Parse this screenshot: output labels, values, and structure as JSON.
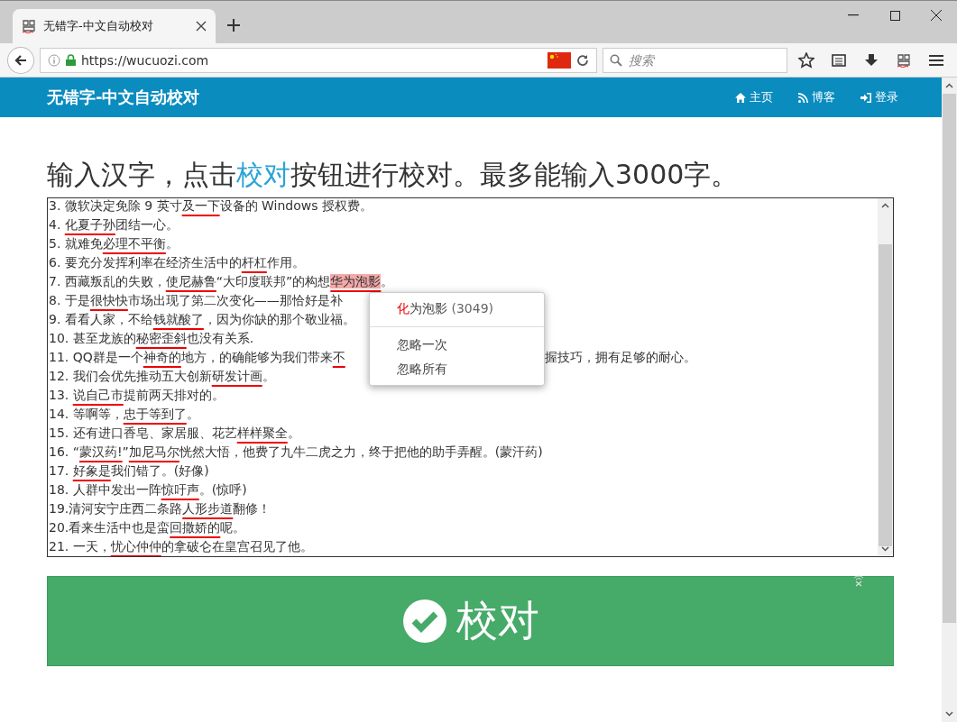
{
  "browser": {
    "tab_title": "无错字-中文自动校对",
    "url": "https://wucuozi.com",
    "search": {
      "placeholder": "搜索"
    }
  },
  "nav": {
    "brand": "无错字-中文自动校对",
    "links": [
      {
        "kind": "home",
        "label": "主页"
      },
      {
        "kind": "rss",
        "label": "博客"
      },
      {
        "kind": "login",
        "label": "登录"
      }
    ]
  },
  "heading": {
    "before": "输入汉字，点击",
    "link": "校对",
    "after": "按钮进行校对。最多能输入3000字。"
  },
  "editor": {
    "lines": [
      {
        "segments": [
          {
            "kind": "plain",
            "text": "3. 微软决定免除 9 英寸"
          },
          {
            "kind": "error",
            "text": "及一下"
          },
          {
            "kind": "plain",
            "text": "设备的 Windows 授权费。"
          }
        ]
      },
      {
        "segments": [
          {
            "kind": "plain",
            "text": "4. "
          },
          {
            "kind": "error",
            "text": "化夏子孙"
          },
          {
            "kind": "plain",
            "text": "团结一心。"
          }
        ]
      },
      {
        "segments": [
          {
            "kind": "plain",
            "text": "5. 就难免"
          },
          {
            "kind": "error",
            "text": "必理不平衡"
          },
          {
            "kind": "plain",
            "text": "。"
          }
        ]
      },
      {
        "segments": [
          {
            "kind": "plain",
            "text": "6. 要充分发挥利率在经济生活中的"
          },
          {
            "kind": "error",
            "text": "杆杠"
          },
          {
            "kind": "plain",
            "text": "作用。"
          }
        ]
      },
      {
        "segments": [
          {
            "kind": "plain",
            "text": "7. 西藏叛乱的失败，"
          },
          {
            "kind": "error",
            "text": "使尼赫鲁"
          },
          {
            "kind": "plain",
            "text": "“大印度联邦”的构想"
          },
          {
            "kind": "active",
            "text": "华为泡影"
          },
          {
            "kind": "plain",
            "text": "。"
          }
        ]
      },
      {
        "segments": [
          {
            "kind": "plain",
            "text": "8. 于是"
          },
          {
            "kind": "error",
            "text": "很快快"
          },
          {
            "kind": "plain",
            "text": "市场出现了第二次变化——那恰好是补"
          }
        ]
      },
      {
        "segments": [
          {
            "kind": "plain",
            "text": "9. 看看人家，不给"
          },
          {
            "kind": "error",
            "text": "钱就酸了"
          },
          {
            "kind": "plain",
            "text": "，因为你缺的那个敬业福。"
          }
        ]
      },
      {
        "segments": [
          {
            "kind": "plain",
            "text": "10. 甚至龙族的"
          },
          {
            "kind": "error",
            "text": "秘密歪斜"
          },
          {
            "kind": "plain",
            "text": "也没有关系."
          }
        ]
      },
      {
        "segments": [
          {
            "kind": "plain",
            "text": "11. QQ群是一个"
          },
          {
            "kind": "error",
            "text": "神奇的"
          },
          {
            "kind": "plain",
            "text": "地方，的确能够为我们带来"
          },
          {
            "kind": "error",
            "text": "不"
          }
        ],
        "right_of_menu": "握技巧，拥有足够的耐心。"
      },
      {
        "segments": [
          {
            "kind": "plain",
            "text": "12. 我们会优先推动五大创新"
          },
          {
            "kind": "error",
            "text": "研发计画"
          },
          {
            "kind": "plain",
            "text": "。"
          }
        ]
      },
      {
        "segments": [
          {
            "kind": "plain",
            "text": "13. "
          },
          {
            "kind": "error",
            "text": "说自己市"
          },
          {
            "kind": "plain",
            "text": "提前两天排对的。"
          }
        ]
      },
      {
        "segments": [
          {
            "kind": "plain",
            "text": "14. 等啊等，"
          },
          {
            "kind": "error",
            "text": "忠于等到了"
          },
          {
            "kind": "plain",
            "text": "。"
          }
        ]
      },
      {
        "segments": [
          {
            "kind": "plain",
            "text": "15. 还有进口香皂、家居服、花艺"
          },
          {
            "kind": "error",
            "text": "样样聚全"
          },
          {
            "kind": "plain",
            "text": "。"
          }
        ]
      },
      {
        "segments": [
          {
            "kind": "plain",
            "text": "16. “"
          },
          {
            "kind": "error",
            "text": "蒙汉药!"
          },
          {
            "kind": "plain",
            "text": "”"
          },
          {
            "kind": "error",
            "text": "加尼马尔"
          },
          {
            "kind": "plain",
            "text": "恍然大悟，他费了九牛二虎之力，终于把他的助手弄醒。(蒙汗药)"
          }
        ]
      },
      {
        "segments": [
          {
            "kind": "plain",
            "text": "17. "
          },
          {
            "kind": "error",
            "text": "好象是"
          },
          {
            "kind": "plain",
            "text": "我们错了。(好像)"
          }
        ]
      },
      {
        "segments": [
          {
            "kind": "plain",
            "text": "18. 人群中发出一阵"
          },
          {
            "kind": "error",
            "text": "惊吁声"
          },
          {
            "kind": "plain",
            "text": "。(惊呼)"
          }
        ]
      },
      {
        "segments": [
          {
            "kind": "plain",
            "text": "19.清河安宁庄西二条路"
          },
          {
            "kind": "error",
            "text": "人形步道"
          },
          {
            "kind": "plain",
            "text": "翻修！"
          }
        ]
      },
      {
        "segments": [
          {
            "kind": "plain",
            "text": "20.看来生活中也是蛮"
          },
          {
            "kind": "error",
            "text": "回撒娇的"
          },
          {
            "kind": "plain",
            "text": "呢。"
          }
        ]
      },
      {
        "segments": [
          {
            "kind": "plain",
            "text": "21. 一天，"
          },
          {
            "kind": "error",
            "text": "忧心仲仲"
          },
          {
            "kind": "plain",
            "text": "的拿破仑在皇宫召见了他。"
          }
        ]
      }
    ]
  },
  "context_menu": {
    "suggestion": {
      "changed": "化",
      "rest": "为泡影",
      "count": "(3049)"
    },
    "items": [
      "忽略一次",
      "忽略所有"
    ]
  },
  "check_button": {
    "label": "校对"
  }
}
